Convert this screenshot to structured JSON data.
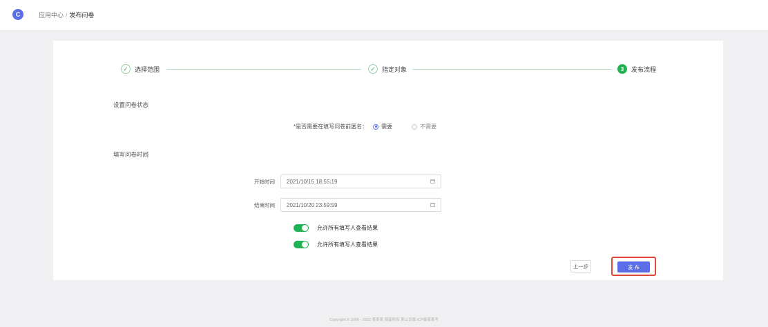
{
  "app": {
    "logo": "C"
  },
  "breadcrumb": {
    "parent": "应用中心",
    "current": "发布问卷"
  },
  "steps": [
    {
      "label": "选择范围",
      "status": "done"
    },
    {
      "label": "指定对象",
      "status": "done"
    },
    {
      "label": "发布流程",
      "status": "active",
      "number": "3"
    }
  ],
  "sections": {
    "settings_title": "设置问卷状态",
    "time_title": "填写问卷时间"
  },
  "anonymous": {
    "label": "*是否需要在填写问卷前匿名：",
    "options": [
      "需要",
      "不需要"
    ],
    "selected": "需要"
  },
  "fields": {
    "start": {
      "label": "开始时间",
      "value": "2021/10/15 18:55:19"
    },
    "end": {
      "label": "结束时间",
      "value": "2021/10/20 23:59:59"
    }
  },
  "toggles": [
    {
      "label": "允许所有填写人查看结果",
      "on": true
    },
    {
      "label": "允许所有填写人查看结果",
      "on": true
    }
  ],
  "buttons": {
    "prev": "上一步",
    "publish": "发 布"
  },
  "footer": "Copyright © 2006 - 2022 某某某 保留所有 某公司版 ICP备某某号"
}
